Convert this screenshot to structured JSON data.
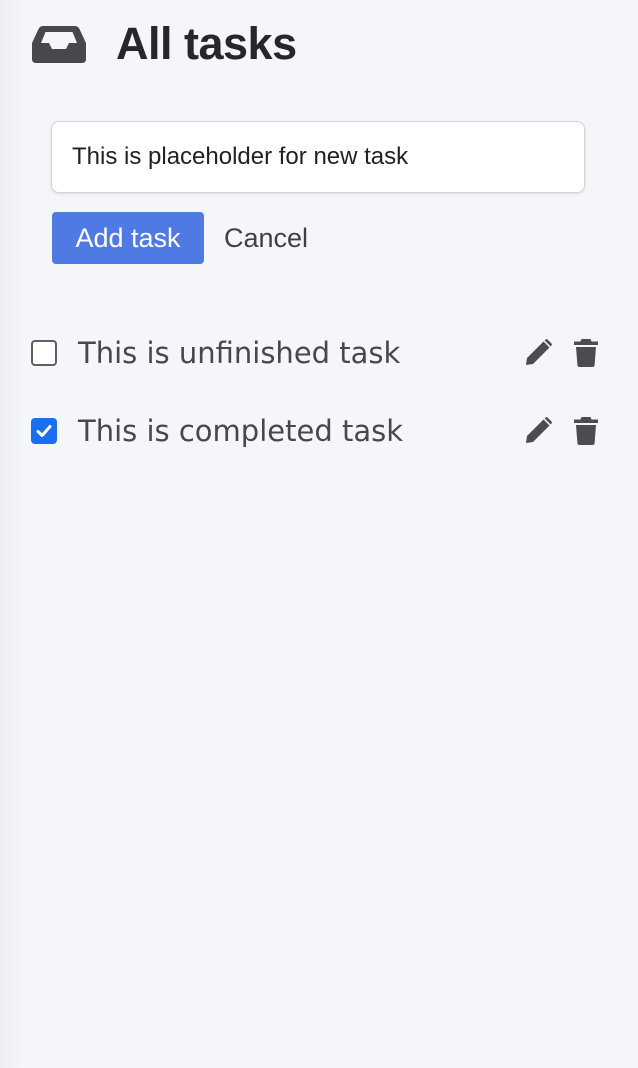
{
  "header": {
    "icon": "inbox-icon",
    "title": "All tasks"
  },
  "new_task": {
    "placeholder": "This is placeholder for new task",
    "add_label": "Add task",
    "cancel_label": "Cancel"
  },
  "tasks": [
    {
      "label": "This is unfinished task",
      "completed": false,
      "edit_icon": "pencil-icon",
      "delete_icon": "trash-icon"
    },
    {
      "label": "This is completed task",
      "completed": true,
      "edit_icon": "pencil-icon",
      "delete_icon": "trash-icon"
    }
  ],
  "colors": {
    "background": "#f5f6fa",
    "primary_button": "#4f79e3",
    "checkbox_checked": "#1a6ef0",
    "title_text": "#25272d",
    "task_text": "#46484e",
    "icon": "#4a4c52"
  }
}
